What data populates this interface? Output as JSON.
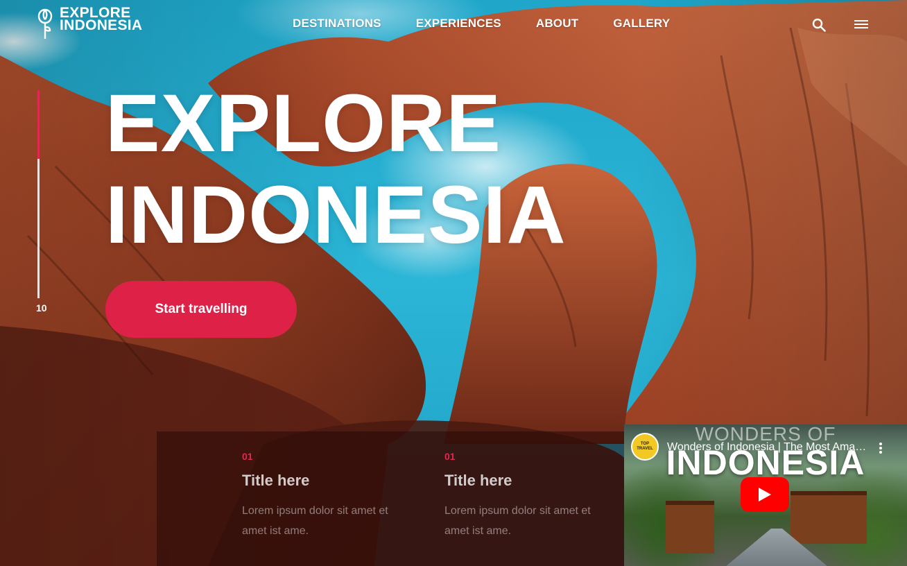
{
  "brand": {
    "line1": "EXPLORE",
    "line2": "INDONESIA",
    "icon": "flower-logo-icon"
  },
  "nav": {
    "items": [
      "DESTINATIONS",
      "EXPERIENCES",
      "ABOUT",
      "GALLERY"
    ]
  },
  "header_icons": {
    "search": "search-icon",
    "menu": "hamburger-menu-icon"
  },
  "slider": {
    "current": "10",
    "progress": 0.33
  },
  "hero": {
    "line1": "EXPLORE",
    "line2": "INDONESIA",
    "cta_label": "Start travelling"
  },
  "cards": [
    {
      "number": "01",
      "title": "Title here",
      "description": "Lorem ipsum dolor sit amet et amet ist ame."
    },
    {
      "number": "01",
      "title": "Title here",
      "description": "Lorem ipsum dolor sit amet et amet ist ame."
    }
  ],
  "video": {
    "channel_label": "TOP TRAVEL",
    "title": "Wonders of Indonesia | The Most Amazing Places in Indonesia",
    "overlay_top": "WONDERS OF",
    "overlay_big": "INDONESIA",
    "play_icon": "youtube-play-icon",
    "more_icon": "more-vertical-icon"
  },
  "colors": {
    "accent": "#de2147",
    "sky": "#2bb5d6",
    "rock": "#9c3d22"
  }
}
